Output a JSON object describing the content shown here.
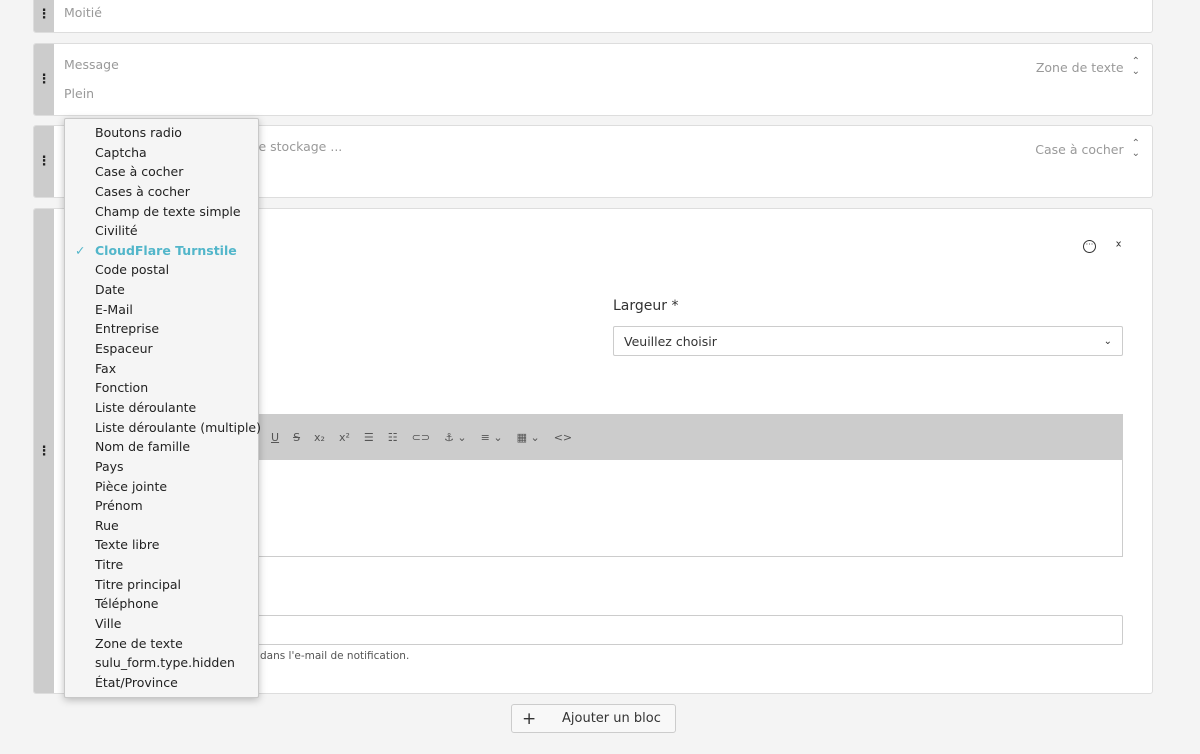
{
  "blocks": [
    {
      "width": "Moitié"
    },
    {
      "label": "Message",
      "width": "Plein",
      "type": "Zone de texte"
    },
    {
      "label": "le stockage ...",
      "type": "Case à cocher"
    }
  ],
  "editor": {
    "width_label": "Largeur *",
    "width_select": "Veuillez choisir",
    "help_text": "dans l'e-mail de notification.",
    "toolbar": [
      "U",
      "S",
      "x₂",
      "x²",
      "list-bullet",
      "list-numbered",
      "link",
      "anchor",
      "align",
      "table",
      "source"
    ]
  },
  "dropdown": {
    "selected": "CloudFlare Turnstile",
    "options": [
      "Boutons radio",
      "Captcha",
      "Case à cocher",
      "Cases à cocher",
      "Champ de texte simple",
      "Civilité",
      "CloudFlare Turnstile",
      "Code postal",
      "Date",
      "E-Mail",
      "Entreprise",
      "Espaceur",
      "Fax",
      "Fonction",
      "Liste déroulante",
      "Liste déroulante (multiple)",
      "Nom de famille",
      "Pays",
      "Pièce jointe",
      "Prénom",
      "Rue",
      "Texte libre",
      "Titre",
      "Titre principal",
      "Téléphone",
      "Ville",
      "Zone de texte",
      "sulu_form.type.hidden",
      "État/Province"
    ]
  },
  "add_block_label": "Ajouter un bloc",
  "colors": {
    "accent": "#52b6ca",
    "handle": "#cccccc"
  }
}
